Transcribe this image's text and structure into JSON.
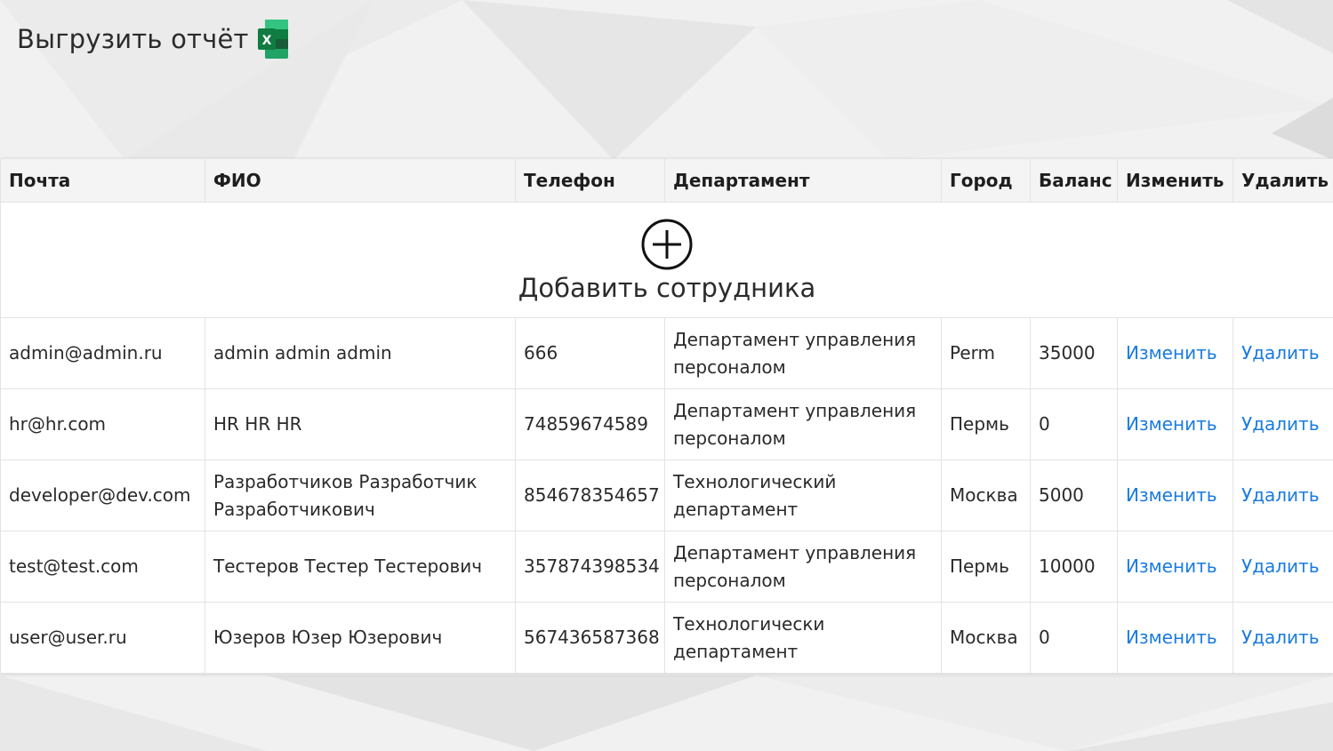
{
  "toolbar": {
    "export_label": "Выгрузить отчёт",
    "export_icon": "excel-icon"
  },
  "table": {
    "headers": [
      "Почта",
      "ФИО",
      "Телефон",
      "Департамент",
      "Город",
      "Баланс",
      "Изменить",
      "Удалить"
    ],
    "add_label": "Добавить сотрудника",
    "add_icon": "plus-circle-icon",
    "rows": [
      {
        "email": "admin@admin.ru",
        "name": "admin admin admin",
        "phone": "666",
        "department": "Департамент управления персоналом",
        "city": "Perm",
        "balance": "35000",
        "edit": "Изменить",
        "delete": "Удалить"
      },
      {
        "email": "hr@hr.com",
        "name": "HR HR HR",
        "phone": "74859674589",
        "department": "Департамент управления персоналом",
        "city": "Пермь",
        "balance": "0",
        "edit": "Изменить",
        "delete": "Удалить"
      },
      {
        "email": "developer@dev.com",
        "name": "Разработчиков Разработчик Разработчикович",
        "phone": "854678354657",
        "department": "Технологический департамент",
        "city": "Москва",
        "balance": "5000",
        "edit": "Изменить",
        "delete": "Удалить"
      },
      {
        "email": "test@test.com",
        "name": "Тестеров Тестер Тестерович",
        "phone": "357874398534",
        "department": "Департамент управления персоналом",
        "city": "Пермь",
        "balance": "10000",
        "edit": "Изменить",
        "delete": "Удалить"
      },
      {
        "email": "user@user.ru",
        "name": "Юзеров Юзер Юзерович",
        "phone": "567436587368",
        "department": "Технологически департамент",
        "city": "Москва",
        "balance": "0",
        "edit": "Изменить",
        "delete": "Удалить"
      }
    ]
  },
  "colors": {
    "link": "#1a7be0",
    "header_bg": "#f4f4f4",
    "excel_green": "#1f7a45"
  }
}
